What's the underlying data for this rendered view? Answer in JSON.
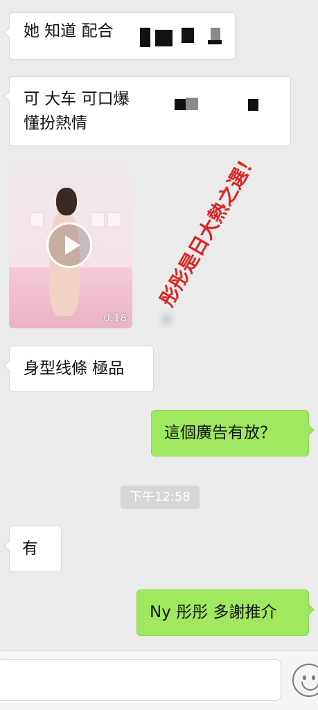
{
  "messages": {
    "m1": "她 知道 配合",
    "m2_line1": "可 大车 可口爆",
    "m2_line2": "懂扮熱情",
    "video_duration": "0:18",
    "m3": "身型线條 極品",
    "m4": "這個廣告有放？",
    "timestamp": "下午12:58",
    "m5": "有",
    "m6": "Ny 彤彤 多謝推介"
  },
  "overlay": {
    "caption": "彤彤是日大熱之選！",
    "color": "#d92424"
  },
  "colors": {
    "background": "#ebebeb",
    "sent_bubble": "#9fe85f",
    "received_bubble": "#ffffff"
  },
  "icons": {
    "emoji": "smiley-face-icon",
    "play": "play-icon"
  }
}
